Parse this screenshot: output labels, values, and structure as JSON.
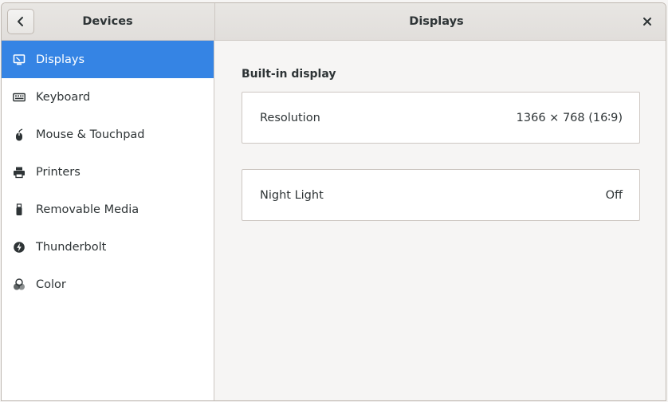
{
  "header": {
    "sidebar_title": "Devices",
    "main_title": "Displays"
  },
  "sidebar": {
    "items": [
      {
        "label": "Displays",
        "icon": "display-icon",
        "active": true
      },
      {
        "label": "Keyboard",
        "icon": "keyboard-icon"
      },
      {
        "label": "Mouse & Touchpad",
        "icon": "mouse-icon"
      },
      {
        "label": "Printers",
        "icon": "printer-icon"
      },
      {
        "label": "Removable Media",
        "icon": "usb-drive-icon"
      },
      {
        "label": "Thunderbolt",
        "icon": "thunderbolt-icon"
      },
      {
        "label": "Color",
        "icon": "color-icon"
      }
    ]
  },
  "main": {
    "section_title": "Built-in display",
    "resolution": {
      "label": "Resolution",
      "value": "1366 × 768 (16∶9)"
    },
    "night_light": {
      "label": "Night Light",
      "value": "Off"
    }
  },
  "colors": {
    "accent": "#3584e4",
    "background": "#f6f5f4",
    "sidebar": "#ffffff"
  }
}
